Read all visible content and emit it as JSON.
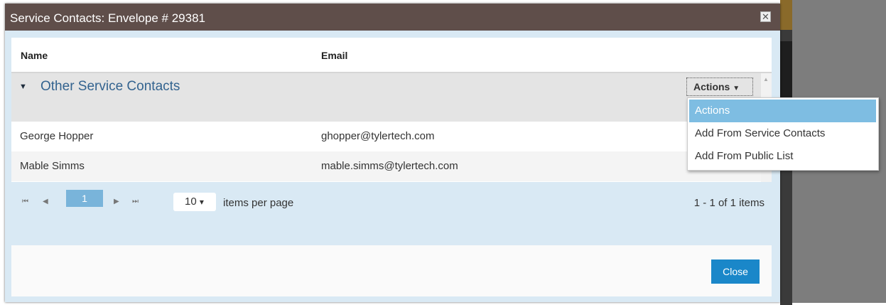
{
  "dialog": {
    "title": "Service Contacts: Envelope # 29381",
    "close_icon": "✕"
  },
  "grid": {
    "columns": [
      "Name",
      "Email"
    ],
    "group": {
      "label": "Other Service Contacts",
      "caret": "▼",
      "actions_label": "Actions",
      "actions_caret": "▼"
    },
    "rows": [
      {
        "name": "George Hopper",
        "email": "ghopper@tylertech.com"
      },
      {
        "name": "Mable Simms",
        "email": "mable.simms@tylertech.com"
      }
    ]
  },
  "pager": {
    "first_icon": "⏮",
    "prev_icon": "◀",
    "current_page": "1",
    "next_icon": "▶",
    "last_icon": "⏭",
    "page_size": "10",
    "page_size_caret": "▾",
    "items_per_page_label": "items per page",
    "info": "1 - 1 of 1 items"
  },
  "actions_menu": {
    "items": [
      "Actions",
      "Add From Service Contacts",
      "Add From Public List"
    ]
  },
  "footer": {
    "close_label": "Close"
  },
  "colors": {
    "titlebar": "#5f4e4a",
    "group_label": "#33638f",
    "menu_active": "#7ebde2",
    "close_button": "#1a87c9"
  }
}
